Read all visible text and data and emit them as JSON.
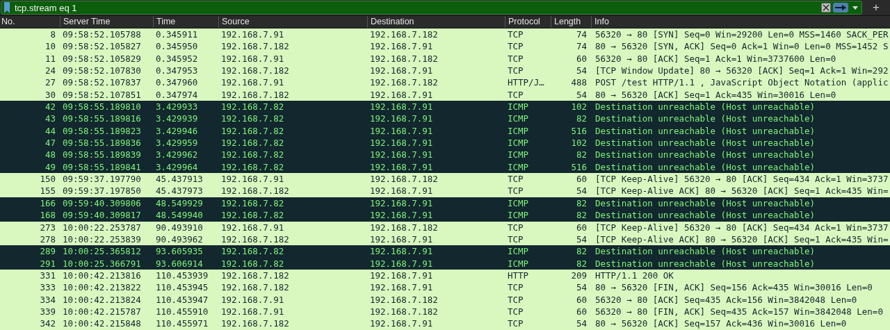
{
  "filter": {
    "value": "tcp.stream eq 1",
    "add_label": "+"
  },
  "columns": [
    "No.",
    "Server Time",
    "Time",
    "Source",
    "Destination",
    "Protocol",
    "Length",
    "Info"
  ],
  "rows": [
    {
      "kind": "normal",
      "cells": [
        "8",
        "09:58:52.105788",
        "0.345911",
        "192.168.7.91",
        "192.168.7.182",
        "TCP",
        "74",
        "56320 → 80 [SYN] Seq=0 Win=29200 Len=0 MSS=1460 SACK_PER"
      ]
    },
    {
      "kind": "normal",
      "cells": [
        "10",
        "09:58:52.105827",
        "0.345950",
        "192.168.7.182",
        "192.168.7.91",
        "TCP",
        "74",
        "80 → 56320 [SYN, ACK] Seq=0 Ack=1 Win=0 Len=0 MSS=1452 S"
      ]
    },
    {
      "kind": "normal",
      "cells": [
        "11",
        "09:58:52.105829",
        "0.345952",
        "192.168.7.91",
        "192.168.7.182",
        "TCP",
        "60",
        "56320 → 80 [ACK] Seq=1 Ack=1 Win=3737600 Len=0"
      ]
    },
    {
      "kind": "normal",
      "cells": [
        "24",
        "09:58:52.107830",
        "0.347953",
        "192.168.7.182",
        "192.168.7.91",
        "TCP",
        "54",
        "[TCP Window Update] 80 → 56320 [ACK] Seq=1 Ack=1 Win=292"
      ]
    },
    {
      "kind": "normal",
      "cells": [
        "27",
        "09:58:52.107837",
        "0.347960",
        "192.168.7.91",
        "192.168.7.182",
        "HTTP/J…",
        "488",
        "POST /test HTTP/1.1 , JavaScript Object Notation (applic"
      ]
    },
    {
      "kind": "normal",
      "cells": [
        "30",
        "09:58:52.107851",
        "0.347974",
        "192.168.7.182",
        "192.168.7.91",
        "TCP",
        "54",
        "80 → 56320 [ACK] Seq=1 Ack=435 Win=30016 Len=0"
      ]
    },
    {
      "kind": "error",
      "cells": [
        "42",
        "09:58:55.189810",
        "3.429933",
        "192.168.7.82",
        "192.168.7.91",
        "ICMP",
        "102",
        "Destination unreachable (Host unreachable)"
      ]
    },
    {
      "kind": "error",
      "cells": [
        "43",
        "09:58:55.189816",
        "3.429939",
        "192.168.7.82",
        "192.168.7.91",
        "ICMP",
        "82",
        "Destination unreachable (Host unreachable)"
      ]
    },
    {
      "kind": "error",
      "cells": [
        "44",
        "09:58:55.189823",
        "3.429946",
        "192.168.7.82",
        "192.168.7.91",
        "ICMP",
        "516",
        "Destination unreachable (Host unreachable)"
      ]
    },
    {
      "kind": "error",
      "cells": [
        "47",
        "09:58:55.189836",
        "3.429959",
        "192.168.7.82",
        "192.168.7.91",
        "ICMP",
        "102",
        "Destination unreachable (Host unreachable)"
      ]
    },
    {
      "kind": "error",
      "cells": [
        "48",
        "09:58:55.189839",
        "3.429962",
        "192.168.7.82",
        "192.168.7.91",
        "ICMP",
        "82",
        "Destination unreachable (Host unreachable)"
      ]
    },
    {
      "kind": "error",
      "cells": [
        "49",
        "09:58:55.189841",
        "3.429964",
        "192.168.7.82",
        "192.168.7.91",
        "ICMP",
        "516",
        "Destination unreachable (Host unreachable)"
      ]
    },
    {
      "kind": "normal",
      "cells": [
        "150",
        "09:59:37.197790",
        "45.437913",
        "192.168.7.91",
        "192.168.7.182",
        "TCP",
        "60",
        "[TCP Keep-Alive] 56320 → 80 [ACK] Seq=434 Ack=1 Win=3737"
      ]
    },
    {
      "kind": "normal",
      "cells": [
        "155",
        "09:59:37.197850",
        "45.437973",
        "192.168.7.182",
        "192.168.7.91",
        "TCP",
        "54",
        "[TCP Keep-Alive ACK] 80 → 56320 [ACK] Seq=1 Ack=435 Win="
      ]
    },
    {
      "kind": "error",
      "cells": [
        "166",
        "09:59:40.309806",
        "48.549929",
        "192.168.7.82",
        "192.168.7.91",
        "ICMP",
        "82",
        "Destination unreachable (Host unreachable)"
      ]
    },
    {
      "kind": "error",
      "cells": [
        "168",
        "09:59:40.309817",
        "48.549940",
        "192.168.7.82",
        "192.168.7.91",
        "ICMP",
        "82",
        "Destination unreachable (Host unreachable)"
      ]
    },
    {
      "kind": "normal",
      "cells": [
        "273",
        "10:00:22.253787",
        "90.493910",
        "192.168.7.91",
        "192.168.7.182",
        "TCP",
        "60",
        "[TCP Keep-Alive] 56320 → 80 [ACK] Seq=434 Ack=1 Win=3737"
      ]
    },
    {
      "kind": "normal",
      "cells": [
        "278",
        "10:00:22.253839",
        "90.493962",
        "192.168.7.182",
        "192.168.7.91",
        "TCP",
        "54",
        "[TCP Keep-Alive ACK] 80 → 56320 [ACK] Seq=1 Ack=435 Win="
      ]
    },
    {
      "kind": "error",
      "cells": [
        "289",
        "10:00:25.365812",
        "93.605935",
        "192.168.7.82",
        "192.168.7.91",
        "ICMP",
        "82",
        "Destination unreachable (Host unreachable)"
      ]
    },
    {
      "kind": "error",
      "cells": [
        "291",
        "10:00:25.366791",
        "93.606914",
        "192.168.7.82",
        "192.168.7.91",
        "ICMP",
        "82",
        "Destination unreachable (Host unreachable)"
      ]
    },
    {
      "kind": "normal",
      "cells": [
        "331",
        "10:00:42.213816",
        "110.453939",
        "192.168.7.182",
        "192.168.7.91",
        "HTTP",
        "209",
        "HTTP/1.1 200 OK"
      ]
    },
    {
      "kind": "normal",
      "cells": [
        "333",
        "10:00:42.213822",
        "110.453945",
        "192.168.7.182",
        "192.168.7.91",
        "TCP",
        "54",
        "80 → 56320 [FIN, ACK] Seq=156 Ack=435 Win=30016 Len=0"
      ]
    },
    {
      "kind": "normal",
      "cells": [
        "334",
        "10:00:42.213824",
        "110.453947",
        "192.168.7.91",
        "192.168.7.182",
        "TCP",
        "60",
        "56320 → 80 [ACK] Seq=435 Ack=156 Win=3842048 Len=0"
      ]
    },
    {
      "kind": "normal",
      "cells": [
        "339",
        "10:00:42.215787",
        "110.455910",
        "192.168.7.91",
        "192.168.7.182",
        "TCP",
        "60",
        "56320 → 80 [FIN, ACK] Seq=435 Ack=157 Win=3842048 Len=0"
      ]
    },
    {
      "kind": "normal",
      "cells": [
        "342",
        "10:00:42.215848",
        "110.455971",
        "192.168.7.182",
        "192.168.7.91",
        "TCP",
        "54",
        "80 → 56320 [ACK] Seq=157 Ack=436 Win=30016 Len=0"
      ]
    }
  ]
}
